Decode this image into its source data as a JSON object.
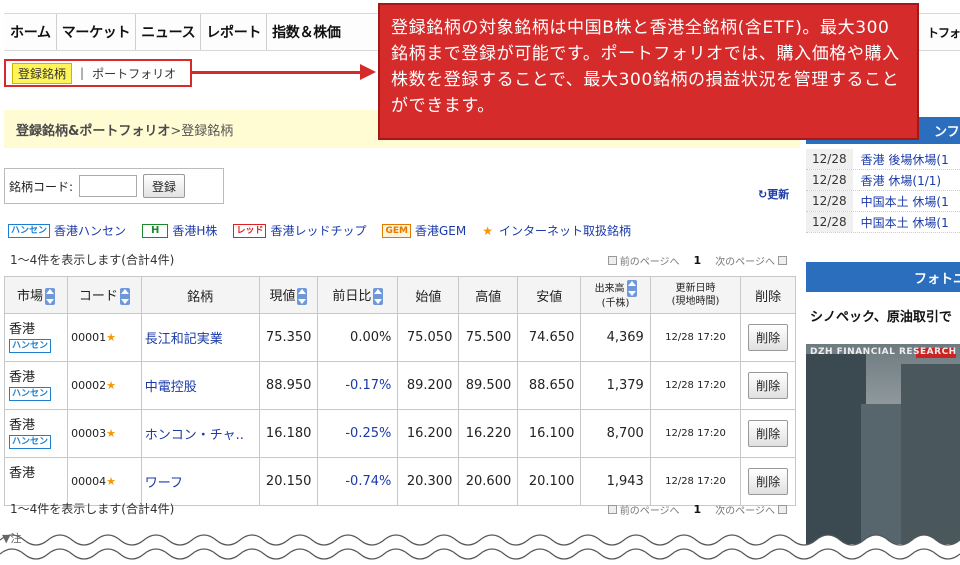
{
  "topnav": {
    "items": [
      "ホーム",
      "マーケット",
      "ニュース",
      "レポート",
      "指数＆株価"
    ],
    "right_fragment": "トフォ"
  },
  "subnav": {
    "active": "登録銘柄",
    "separator": "|",
    "link": "ポートフォリオ"
  },
  "callout": {
    "text": "登録銘柄の対象銘柄は中国B株と香港全銘柄(含ETF)。最大300銘柄まで登録が可能です。ポートフォリオでは、購入価格や購入株数を登録することで、最大300銘柄の損益状況を管理することができます。",
    "color": "#d52b2b"
  },
  "breadcrumb": {
    "strong": "登録銘柄&ポートフォリオ",
    "rest": " >登録銘柄"
  },
  "codebox": {
    "label": "銘柄コード:",
    "input_value": "",
    "button": "登録"
  },
  "refresh": "更新",
  "legend": [
    {
      "tag": "ハンセン",
      "label": "香港ハンセン",
      "kind": "hansen"
    },
    {
      "tag": "H",
      "label": "香港H株",
      "kind": "h"
    },
    {
      "tag": "レッド",
      "label": "香港レッドチップ",
      "kind": "red"
    },
    {
      "tag": "GEM",
      "label": "香港GEM",
      "kind": "gem"
    },
    {
      "tag": "★",
      "label": "インターネット取扱銘柄",
      "kind": "star"
    }
  ],
  "count_text": "1〜4件を表示します(合計4件)",
  "pager": {
    "prev": "前のページへ",
    "current": "1",
    "next": "次のページへ"
  },
  "table": {
    "headers": {
      "market": "市場",
      "code": "コード",
      "name": "銘柄",
      "price": "現値",
      "change": "前日比",
      "open": "始値",
      "high": "高値",
      "low": "安値",
      "volume_1": "出来高",
      "volume_2": "(千株)",
      "updated_1": "更新日時",
      "updated_2": "(現地時間)",
      "delete": "削除"
    },
    "rows": [
      {
        "market": "香港",
        "hansen": "ハンセン",
        "code": "00001",
        "name": "長江和記実業",
        "price": "75.350",
        "change": "0.00%",
        "open": "75.050",
        "high": "75.500",
        "low": "74.650",
        "volume": "4,369",
        "time": "12/28 17:20",
        "del": "削除"
      },
      {
        "market": "香港",
        "hansen": "ハンセン",
        "code": "00002",
        "name": "中電控股",
        "price": "88.950",
        "change": "-0.17%",
        "open": "89.200",
        "high": "89.500",
        "low": "88.650",
        "volume": "1,379",
        "time": "12/28 17:20",
        "del": "削除"
      },
      {
        "market": "香港",
        "hansen": "ハンセン",
        "code": "00003",
        "name": "ホンコン・チャ..",
        "price": "16.180",
        "change": "-0.25%",
        "open": "16.200",
        "high": "16.220",
        "low": "16.100",
        "volume": "8,700",
        "time": "12/28 17:20",
        "del": "削除"
      },
      {
        "market": "香港",
        "hansen": "",
        "code": "00004",
        "name": "ワーフ",
        "price": "20.150",
        "change": "-0.74%",
        "open": "20.300",
        "high": "20.600",
        "low": "20.100",
        "volume": "1,943",
        "time": "12/28 17:20",
        "del": "削除"
      }
    ]
  },
  "right_column": {
    "header_fragment": "ンフォ",
    "holidays": [
      {
        "date": "12/28",
        "text": "香港 後場休場(1"
      },
      {
        "date": "12/28",
        "text": "香港 休場(1/1)"
      },
      {
        "date": "12/28",
        "text": "中国本土 休場(1"
      },
      {
        "date": "12/28",
        "text": "中国本土 休場(1"
      }
    ],
    "photo_bar": "フォトニ",
    "headline": "シノペック、原油取引で",
    "photo_credit": "DZH FINANCIAL RESEARCH"
  },
  "note": "▼注"
}
